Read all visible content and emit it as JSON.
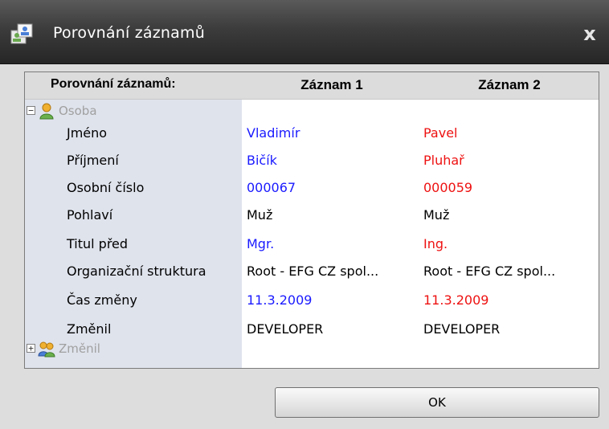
{
  "window": {
    "title": "Porovnání záznamů",
    "close_glyph": "x"
  },
  "table": {
    "header": {
      "label": "Porovnání záznamů:",
      "col1": "Záznam 1",
      "col2": "Záznam 2"
    },
    "groups": [
      {
        "label": "Osoba",
        "expander": "−",
        "icon": "person-icon"
      },
      {
        "label": "Změnil",
        "expander": "+",
        "icon": "users-icon"
      }
    ],
    "rows": [
      {
        "label": "Jméno",
        "v1": "Vladimír",
        "v2": "Pavel",
        "differs": true
      },
      {
        "label": "Příjmení",
        "v1": "Bičík",
        "v2": "Pluhař",
        "differs": true
      },
      {
        "label": "Osobní číslo",
        "v1": "000067",
        "v2": "000059",
        "differs": true
      },
      {
        "label": "Pohlaví",
        "v1": "Muž",
        "v2": "Muž",
        "differs": false
      },
      {
        "label": "Titul před",
        "v1": "Mgr.",
        "v2": "Ing.",
        "differs": true
      },
      {
        "label": "Organizační struktura",
        "v1": "Root - EFG CZ spol...",
        "v2": "Root - EFG CZ spol...",
        "differs": false
      },
      {
        "label": "Čas změny",
        "v1": "11.3.2009",
        "v2": "11.3.2009",
        "differs": true
      },
      {
        "label": "Změnil",
        "v1": "DEVELOPER",
        "v2": "DEVELOPER",
        "differs": false
      }
    ]
  },
  "buttons": {
    "ok_label": "OK"
  },
  "colors": {
    "record1": "#1a1aff",
    "record2": "#ee1111",
    "same": "#000000"
  }
}
